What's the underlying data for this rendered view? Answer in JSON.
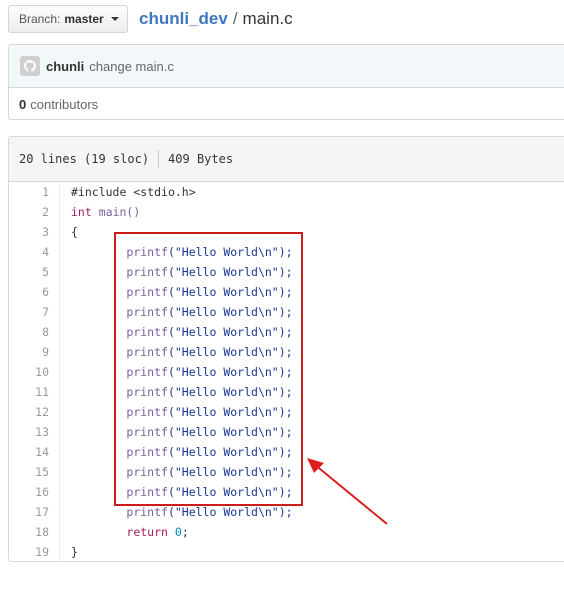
{
  "branch": {
    "label": "Branch:",
    "name": "master"
  },
  "breadcrumb": {
    "repo": "chunli_dev",
    "separator": "/",
    "file": "main.c"
  },
  "commit": {
    "author": "chunli",
    "message": "change main.c"
  },
  "contributors": {
    "count": "0",
    "label": "contributors"
  },
  "file_info": {
    "lines": "20 lines (19 sloc)",
    "size": "409 Bytes"
  },
  "code_lines": [
    {
      "n": "1"
    },
    {
      "n": "2"
    },
    {
      "n": "3"
    },
    {
      "n": "4"
    },
    {
      "n": "5"
    },
    {
      "n": "6"
    },
    {
      "n": "7"
    },
    {
      "n": "8"
    },
    {
      "n": "9"
    },
    {
      "n": "10"
    },
    {
      "n": "11"
    },
    {
      "n": "12"
    },
    {
      "n": "13"
    },
    {
      "n": "14"
    },
    {
      "n": "15"
    },
    {
      "n": "16"
    },
    {
      "n": "17"
    },
    {
      "n": "18"
    },
    {
      "n": "19"
    }
  ],
  "code": {
    "include_kw": "#include",
    "include_hdr": "<stdio.h>",
    "int_kw": "int",
    "main_fn": "main()",
    "open_brace": "{",
    "printf_fn": "printf",
    "printf_arg": "(\"Hello World\\n\");",
    "return_kw": "return",
    "return_val": "0",
    "return_end": ";",
    "close_brace": "}"
  },
  "colors": {
    "highlight_box": "#cc1d1d",
    "arrow": "#dd1e1e",
    "repo_link": "#4078c0"
  }
}
